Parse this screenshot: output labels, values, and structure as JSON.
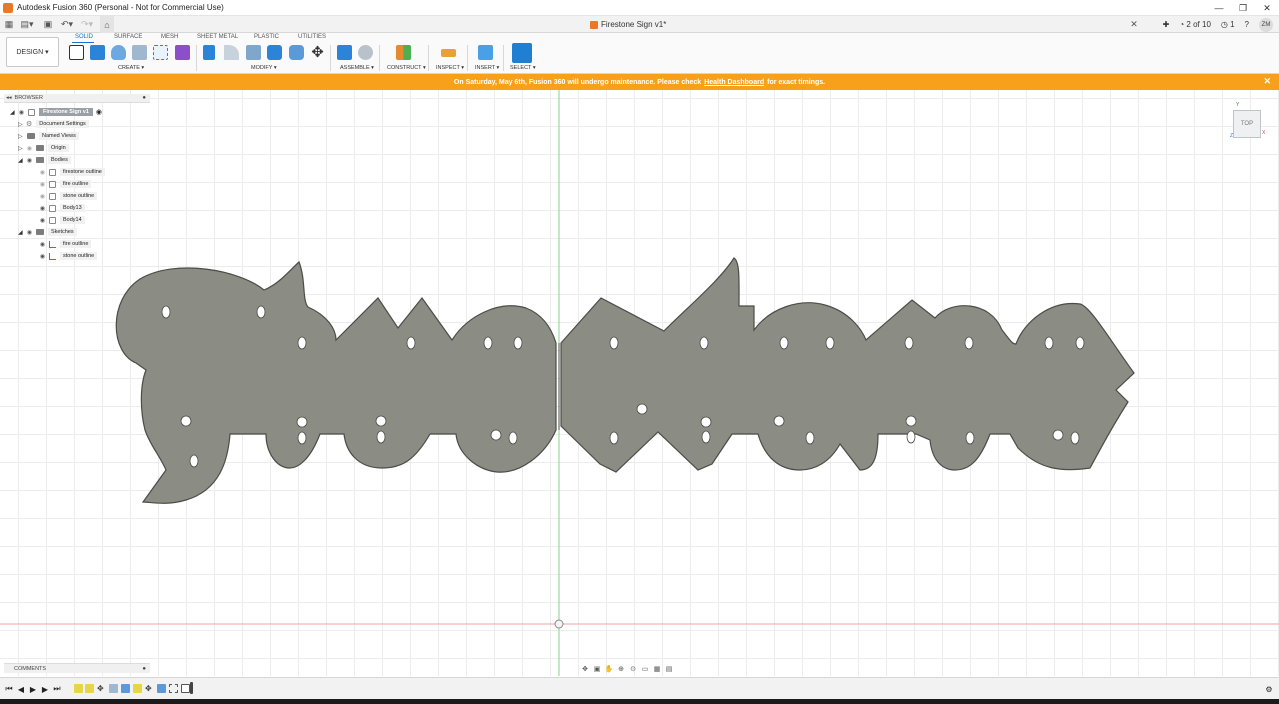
{
  "titlebar": {
    "title": "Autodesk Fusion 360 (Personal - Not for Commercial Use)"
  },
  "document_tab": {
    "name": "Firestone Sign v1*"
  },
  "header_right": {
    "job_status": "2 of 10",
    "notifications": "1",
    "user_initials": "ZM"
  },
  "workspace": {
    "label": "DESIGN ▾"
  },
  "ribbon_tabs": [
    "SOLID",
    "SURFACE",
    "MESH",
    "SHEET METAL",
    "PLASTIC",
    "UTILITIES"
  ],
  "ribbon_groups": {
    "create": "CREATE ▾",
    "modify": "MODIFY ▾",
    "assemble": "ASSEMBLE ▾",
    "construct": "CONSTRUCT ▾",
    "inspect": "INSPECT ▾",
    "insert": "INSERT ▾",
    "select": "SELECT ▾"
  },
  "banner": {
    "text_before": "On Saturday, May 6th, Fusion 360 will undergo maintenance. Please check",
    "link": "Health Dashboard",
    "text_after": "for exact timings."
  },
  "browser": {
    "title": "BROWSER",
    "root": "Firestone Sign v1",
    "items": {
      "document_settings": "Document Settings",
      "named_views": "Named Views",
      "origin": "Origin",
      "bodies": "Bodies",
      "body_1": "firestone outline",
      "body_2": "fire outline",
      "body_3": "stone outline",
      "body_4": "Body13",
      "body_5": "Body14",
      "sketches": "Sketches",
      "sketch_1": "fire outline",
      "sketch_2": "stone outline"
    }
  },
  "viewcube": {
    "face": "TOP",
    "axis_y": "Y",
    "axis_x": "X",
    "axis_z": "Z"
  },
  "comments": {
    "title": "COMMENTS"
  },
  "colors": {
    "accent": "#1a6fd1",
    "banner": "#f7a11b",
    "body_fill": "#8b8d84",
    "body_outline": "#4a4c47",
    "y_axis": "#2c9b2c",
    "x_axis": "#d04444"
  }
}
